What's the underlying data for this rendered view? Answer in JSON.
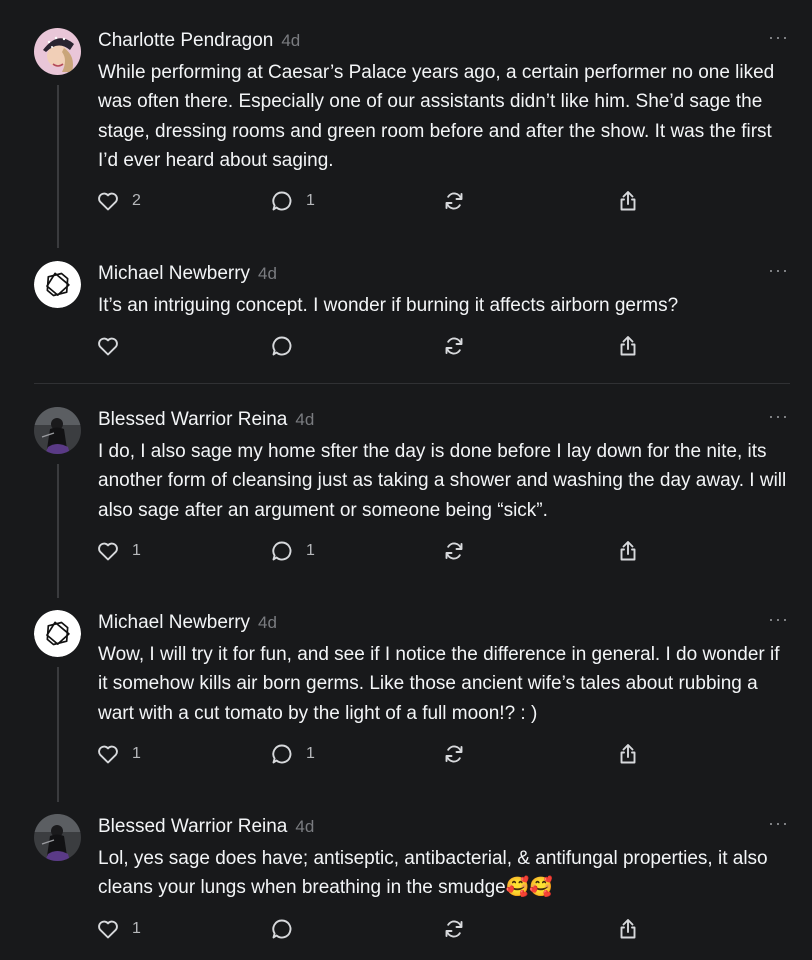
{
  "posts": [
    {
      "author": "Charlotte Pendragon",
      "time": "4d",
      "avatar": "charlotte-avatar",
      "text": "While performing at Caesar’s Palace years ago, a certain performer no one liked was often there. Especially one of our assistants didn’t like him. She’d sage the stage, dressing rooms and green room before and after the show. It was the first I’d ever heard about saging.",
      "likes": "2",
      "replies": "1",
      "more": "···"
    },
    {
      "author": "Michael Newberry",
      "time": "4d",
      "avatar": "michael-avatar",
      "text": "It’s an intriguing concept. I wonder if burning it affects airborn germs?",
      "likes": "",
      "replies": "",
      "more": "···"
    },
    {
      "author": "Blessed Warrior Reina",
      "time": "4d",
      "avatar": "reina-avatar",
      "text": "I do, I also sage my home sfter the day is done before I lay down for the nite, its another form of cleansing just as taking a shower and washing the day away. I will also sage after an argument or someone being “sick”.",
      "likes": "1",
      "replies": "1",
      "more": "···"
    },
    {
      "author": "Michael Newberry",
      "time": "4d",
      "avatar": "michael-avatar",
      "text": "Wow, I will try it for fun, and see if I notice the difference in general. I do wonder if it somehow kills air born germs. Like those ancient wife’s tales about rubbing a wart with a cut tomato by the light of a full moon!? : )",
      "likes": "1",
      "replies": "1",
      "more": "···"
    },
    {
      "author": "Blessed Warrior Reina",
      "time": "4d",
      "avatar": "reina-avatar",
      "text": "Lol, yes sage does have; antiseptic, antibacterial, & antifungal properties, it also cleans your lungs when breathing in the smudge🥰🥰",
      "likes": "1",
      "replies": "",
      "more": "···"
    }
  ],
  "icons": {
    "like": "heart-icon",
    "reply": "comment-bubble-icon",
    "repost": "repost-icon",
    "share": "share-icon",
    "more": "more-options-icon"
  },
  "colors": {
    "background": "#18191b",
    "text": "#f3f5f7",
    "secondary": "#7a7c80",
    "divider": "#303134"
  }
}
